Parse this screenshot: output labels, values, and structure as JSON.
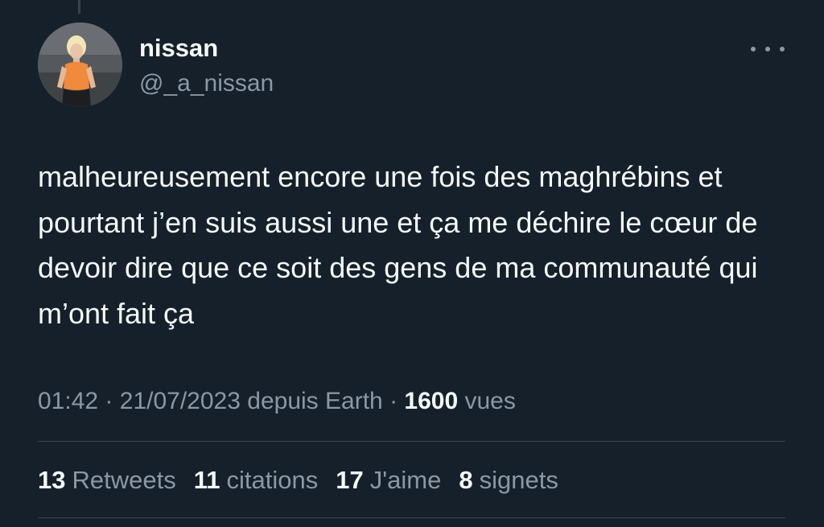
{
  "author": {
    "display_name": "nissan",
    "handle": "@_a_nissan"
  },
  "tweet": {
    "text": "malheureusement encore une fois des maghrébins et pourtant j’en suis aussi une et ça me déchire le cœur de devoir dire que ce soit des gens de ma communauté qui m’ont fait ça",
    "time": "01:42",
    "date": "21/07/2023",
    "source": "depuis Earth",
    "separator": "·",
    "views_count": "1600",
    "views_label": "vues"
  },
  "stats": [
    {
      "count": "13",
      "label": "Retweets"
    },
    {
      "count": "11",
      "label": "citations"
    },
    {
      "count": "17",
      "label": "J'aime"
    },
    {
      "count": "8",
      "label": "signets"
    }
  ],
  "icons": {
    "more": "more-horizontal-icon"
  },
  "colors": {
    "background": "#15202b",
    "text_primary": "#f7f9f9",
    "text_secondary": "#8b98a5",
    "divider": "#38444d"
  }
}
